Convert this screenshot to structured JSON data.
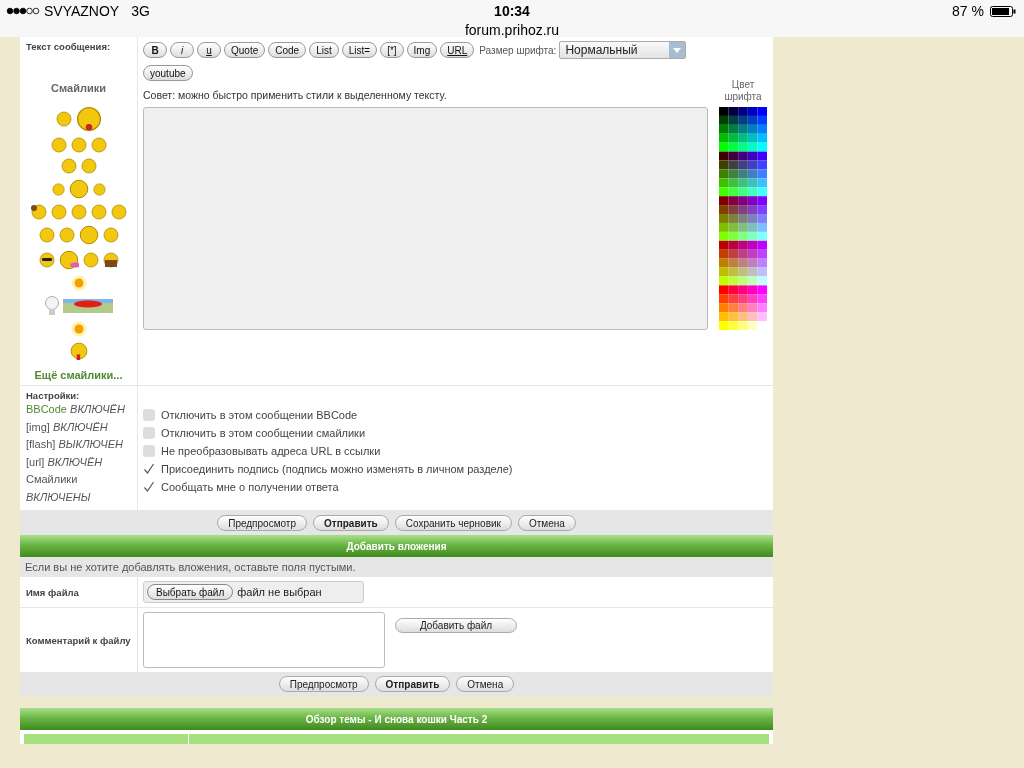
{
  "status_bar": {
    "carrier": "SVYAZNOY",
    "network": "3G",
    "time": "10:34",
    "url": "forum.prihoz.ru",
    "battery": "87 %"
  },
  "message": {
    "label": "Текст сообщения:",
    "toolbar": [
      {
        "label": "B",
        "kind": "bold"
      },
      {
        "label": "i",
        "kind": "italic"
      },
      {
        "label": "u",
        "kind": "underline"
      },
      {
        "label": "Quote",
        "kind": "plain"
      },
      {
        "label": "Code",
        "kind": "plain"
      },
      {
        "label": "List",
        "kind": "plain"
      },
      {
        "label": "List=",
        "kind": "plain"
      },
      {
        "label": "[*]",
        "kind": "plain"
      },
      {
        "label": "Img",
        "kind": "plain"
      },
      {
        "label": "URL",
        "kind": "underline"
      },
      {
        "label": "youtube",
        "kind": "plain"
      }
    ],
    "font_size": {
      "label": "Размер шрифта:",
      "value": "Нормальный"
    },
    "hint": "Совет: можно быстро применить стили к выделенному тексту.",
    "color_label": "Цвет шрифта"
  },
  "smileys": {
    "title": "Смайлики",
    "more": "Ещё смайлики..."
  },
  "settings": {
    "title": "Настройки:",
    "statuses": [
      {
        "text": "BBCode *ВКЛЮЧЁН*",
        "link": true
      },
      {
        "text": "[img] *ВКЛЮЧЁН*",
        "link": false
      },
      {
        "text": "[flash] *ВЫКЛЮЧЕН*",
        "link": false
      },
      {
        "text": "[url] *ВКЛЮЧЁН*",
        "link": false
      },
      {
        "text": "Смайлики *ВКЛЮЧЕНЫ*",
        "link": false
      }
    ],
    "options": [
      {
        "label": "Отключить в этом сообщении BBCode",
        "checked": false
      },
      {
        "label": "Отключить в этом сообщении смайлики",
        "checked": false
      },
      {
        "label": "Не преобразовывать адреса URL в ссылки",
        "checked": false
      },
      {
        "label": "Присоединить подпись (подпись можно изменять в личном разделе)",
        "checked": true
      },
      {
        "label": "Сообщать мне о получении ответа",
        "checked": true
      }
    ]
  },
  "form_buttons": [
    {
      "label": "Предпросмотр",
      "primary": false
    },
    {
      "label": "Отправить",
      "primary": true
    },
    {
      "label": "Сохранить черновик",
      "primary": false
    },
    {
      "label": "Отмена",
      "primary": false
    }
  ],
  "attachments": {
    "title": "Добавить вложения",
    "hint": "Если вы не хотите добавлять вложения, оставьте поля пустыми.",
    "file_label": "Имя файла",
    "choose": "Выбрать файл",
    "no_file": "файл не выбран",
    "comment_label": "Комментарий к файлу",
    "add": "Добавить файл",
    "buttons": [
      {
        "label": "Предпросмотр",
        "primary": false
      },
      {
        "label": "Отправить",
        "primary": true
      },
      {
        "label": "Отмена",
        "primary": false
      }
    ]
  },
  "topic_review": {
    "title": "Обзор темы - И снова кошки Часть 2"
  }
}
